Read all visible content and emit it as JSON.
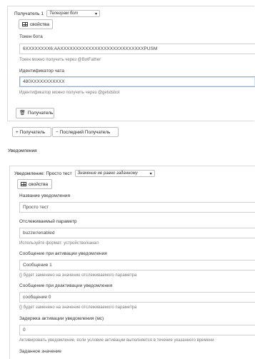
{
  "recipient": {
    "label": "Получатель 1",
    "type_value": "Телеграм бот",
    "props_button": "свойства",
    "token_label": "Токен бота",
    "token_value": "6XXXXXXXX6:AAXXXXXXXXXXXXXXXXXXXXXXXXXXXPUSM",
    "token_help": "Токен можно получить через @BotFather",
    "chat_label": "Идентификатор чата",
    "chat_value": "480XXXXXXXXXXX",
    "chat_help": "Идентификатор можно получить через @getidsbot",
    "delete_button": "Получатель"
  },
  "recipient_actions": {
    "add": "+ Получатель",
    "remove": "− Последний Получатель"
  },
  "notifications": {
    "section_title": "Уведомления",
    "header_label": "Уведомление: Просто тест",
    "condition_value": "Значение не равно заданному",
    "props_button": "свойства",
    "fields": [
      {
        "label": "Название уведомления",
        "value": "Просто тест",
        "help": ""
      },
      {
        "label": "Отслеживаемый параметр",
        "value": "buzzer/enabled",
        "help": "Используйте формат: устройство/канал"
      },
      {
        "label": "Сообщение при активации уведомления",
        "value": "Сообщение 1",
        "help": "{} будет заменено на значение отслеживаемого параметра"
      },
      {
        "label": "Сообщение при деактивации уведомления",
        "value": "сообщение 0",
        "help": "{} будет заменено на значение отслеживаемого параметра"
      },
      {
        "label": "Задержка активации уведомления (мс)",
        "value": "0",
        "help": "Активировать уведомление, если условие активации выполняется в течение указанного времени"
      },
      {
        "label": "Заданное значение",
        "value": "",
        "help": ""
      }
    ]
  },
  "icons": {
    "table": "table-icon",
    "trash": "trash-icon",
    "caret": "caret-down-icon"
  }
}
